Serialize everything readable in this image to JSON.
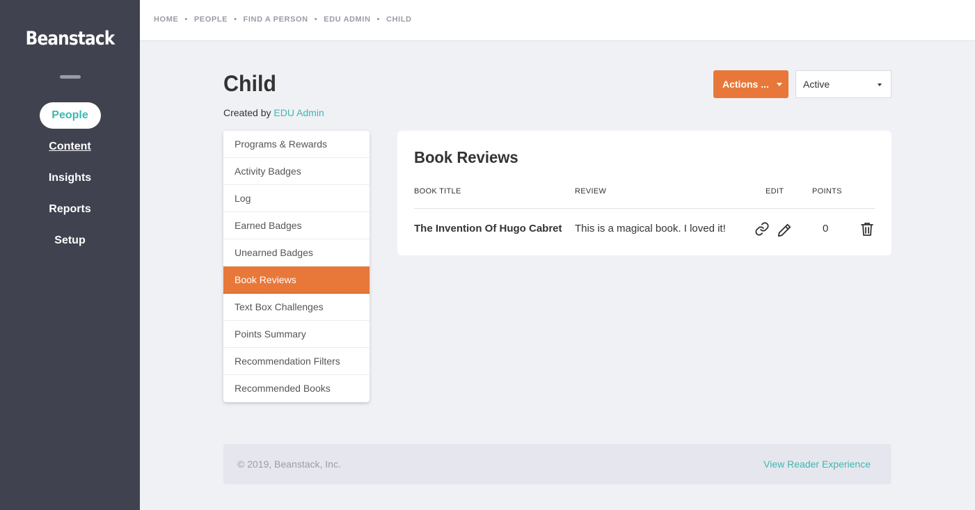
{
  "app": {
    "logo": "Beanstack"
  },
  "sidebar": {
    "items": [
      {
        "label": "People"
      },
      {
        "label": "Content"
      },
      {
        "label": "Insights"
      },
      {
        "label": "Reports"
      },
      {
        "label": "Setup"
      }
    ]
  },
  "breadcrumb": [
    "HOME",
    "PEOPLE",
    "FIND A PERSON",
    "EDU ADMIN",
    "CHILD"
  ],
  "page": {
    "title": "Child",
    "created_prefix": "Created by",
    "created_by": "EDU Admin"
  },
  "toolbar": {
    "actions_label": "Actions ...",
    "status_value": "Active"
  },
  "menu": {
    "items": [
      "Programs & Rewards",
      "Activity Badges",
      "Log",
      "Earned Badges",
      "Unearned Badges",
      "Book Reviews",
      "Text Box Challenges",
      "Points Summary",
      "Recommendation Filters",
      "Recommended Books"
    ],
    "selected": "Book Reviews"
  },
  "reviews": {
    "title": "Book Reviews",
    "columns": {
      "book_title": "BOOK TITLE",
      "review": "REVIEW",
      "edit": "EDIT",
      "points": "POINTS"
    },
    "rows": [
      {
        "book_title": "The Invention Of Hugo Cabret",
        "review": "This is a magical book. I loved it!",
        "points": "0"
      }
    ],
    "icons": [
      "link-icon",
      "pencil-icon",
      "trash-icon"
    ]
  },
  "footer": {
    "copyright": "© 2019, Beanstack, Inc.",
    "link": "View Reader Experience"
  },
  "colors": {
    "sidebar": "#40424f",
    "accent_orange": "#e8783a",
    "accent_teal": "#3cb8b0",
    "background": "#f0f1f5"
  }
}
